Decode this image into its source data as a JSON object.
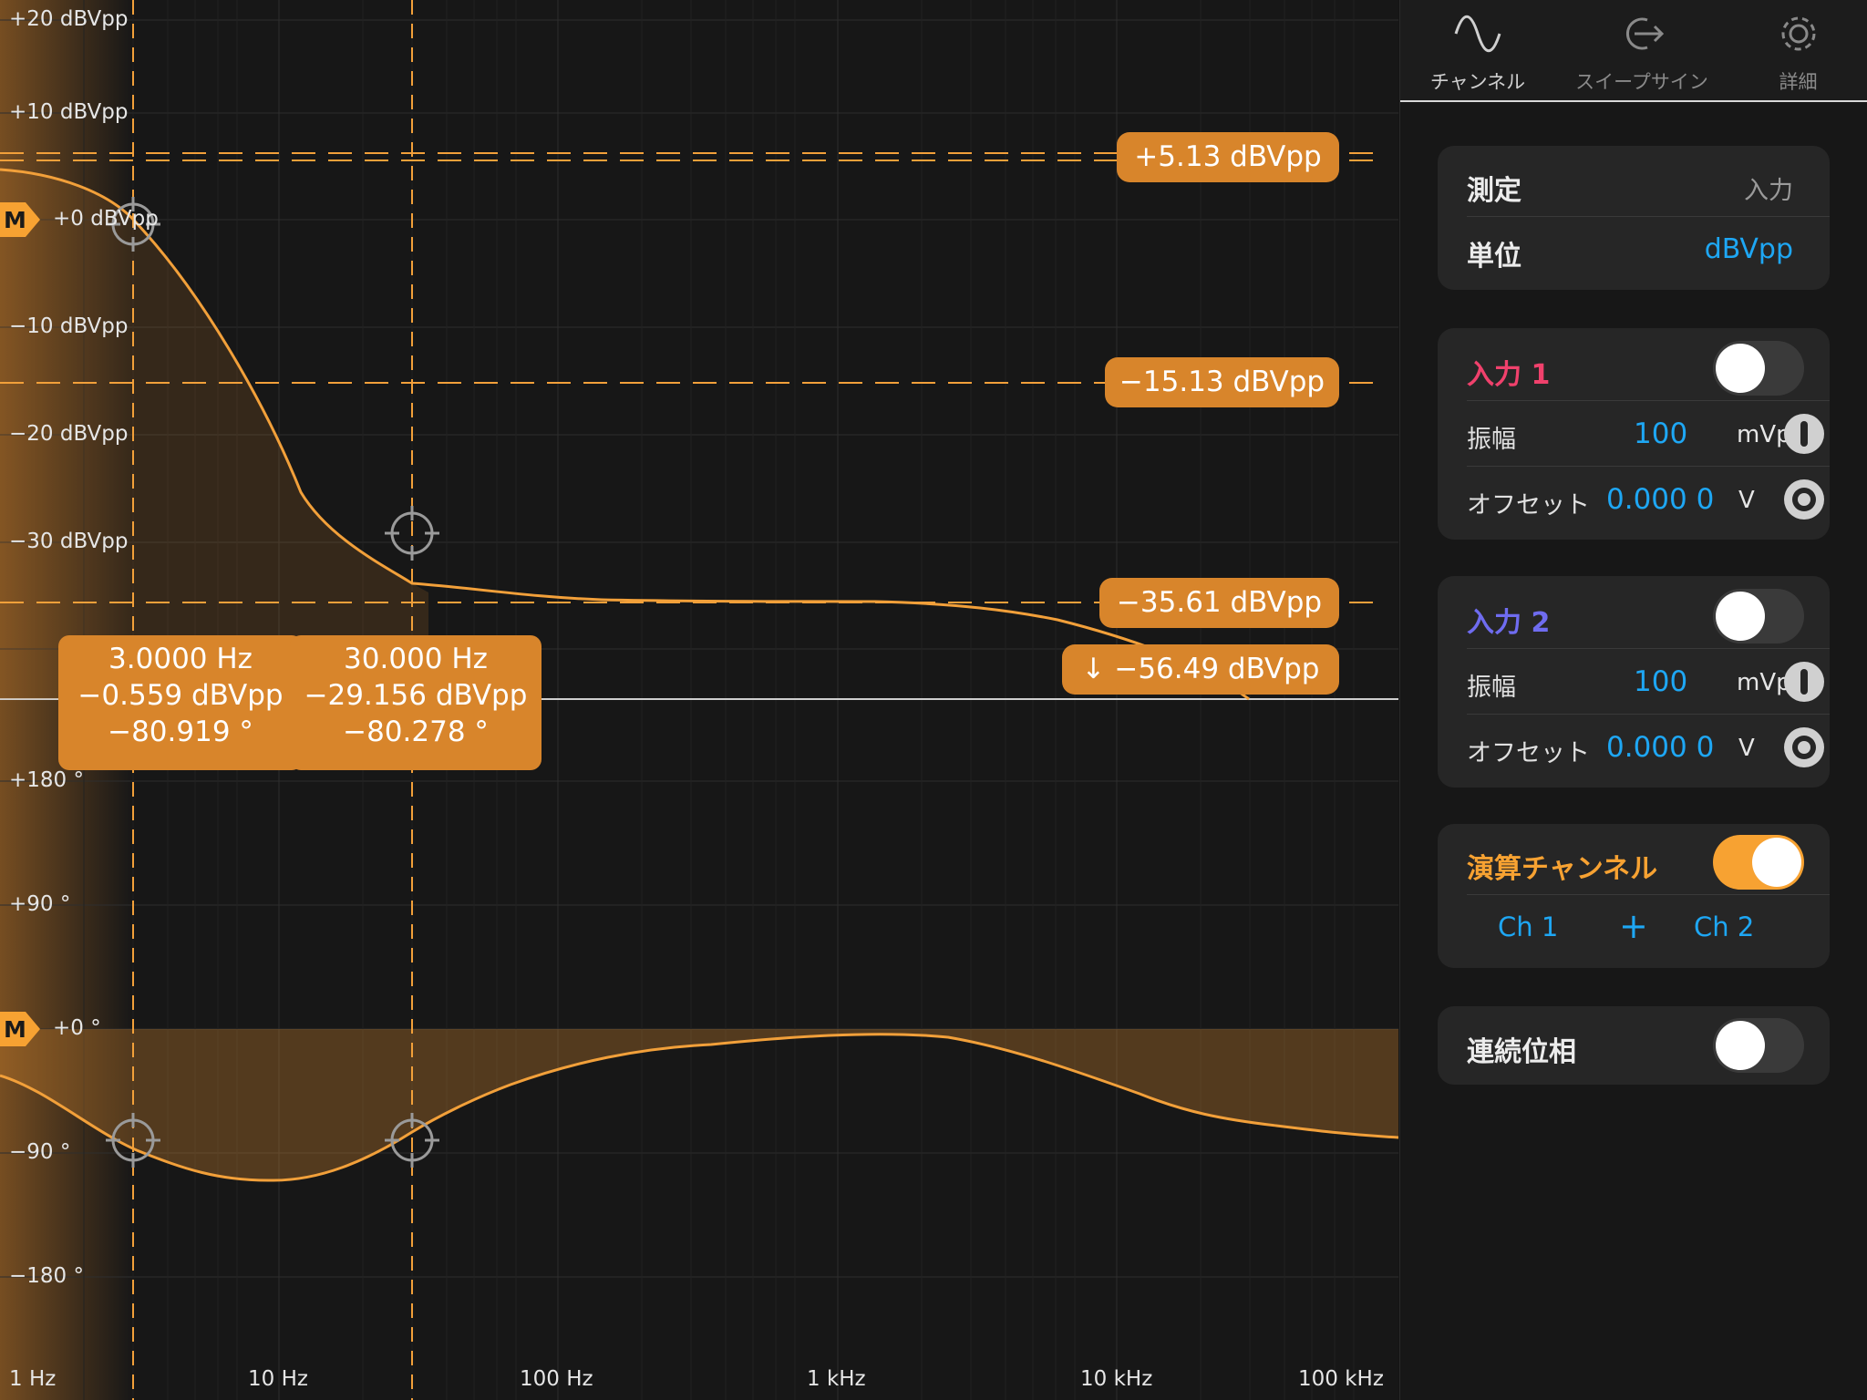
{
  "magnitude_axis": {
    "ticks": [
      "+20 dBVpp",
      "+10 dBVpp",
      "+0 dBVpp",
      "−10 dBVpp",
      "−20 dBVpp",
      "−30 dBVpp"
    ],
    "marker_label": "M"
  },
  "phase_axis": {
    "ticks": [
      "+180 °",
      "+90 °",
      "+0 °",
      "−90 °",
      "−180 °"
    ],
    "marker_label": "M"
  },
  "freq_axis": {
    "ticks": [
      "1 Hz",
      "10 Hz",
      "100 Hz",
      "1 kHz",
      "10 kHz",
      "100 kHz"
    ]
  },
  "level_pills": {
    "p1": "+5.13 dBVpp",
    "p2": "−15.13 dBVpp",
    "p3": "−35.61 dBVpp",
    "p4": "↓ −56.49 dBVpp"
  },
  "cursors": {
    "c1": {
      "freq": "3.0000 Hz",
      "mag": "−0.559 dBVpp",
      "phase": "−80.919 °"
    },
    "c2": {
      "freq": "30.000 Hz",
      "mag": "−29.156 dBVpp",
      "phase": "−80.278 °"
    }
  },
  "tabs": {
    "channel": "チャンネル",
    "sweep": "スイープサイン",
    "details": "詳細"
  },
  "measure_card": {
    "measure_label": "測定",
    "measure_value": "入力",
    "unit_label": "単位",
    "unit_value": "dBVpp"
  },
  "input1": {
    "title": "入力 1",
    "title_color": "#f0416c",
    "enabled": false,
    "amp_label": "振幅",
    "amp_value": "100",
    "amp_unit": "mVpp",
    "offset_label": "オフセット",
    "offset_value": "0.000 0",
    "offset_unit": "V"
  },
  "input2": {
    "title": "入力 2",
    "title_color": "#6f6cf0",
    "enabled": false,
    "amp_label": "振幅",
    "amp_value": "100",
    "amp_unit": "mVpp",
    "offset_label": "オフセット",
    "offset_value": "0.000 0",
    "offset_unit": "V"
  },
  "math_channel": {
    "title": "演算チャンネル",
    "enabled": true,
    "operand_a": "Ch 1",
    "operator": "+",
    "operand_b": "Ch 2"
  },
  "continuous_phase": {
    "title": "連続位相",
    "enabled": false
  },
  "colors": {
    "accent": "#f7a232",
    "trace": "#f2a03a",
    "pill": "#d8852b",
    "blue": "#1ea7f4"
  }
}
